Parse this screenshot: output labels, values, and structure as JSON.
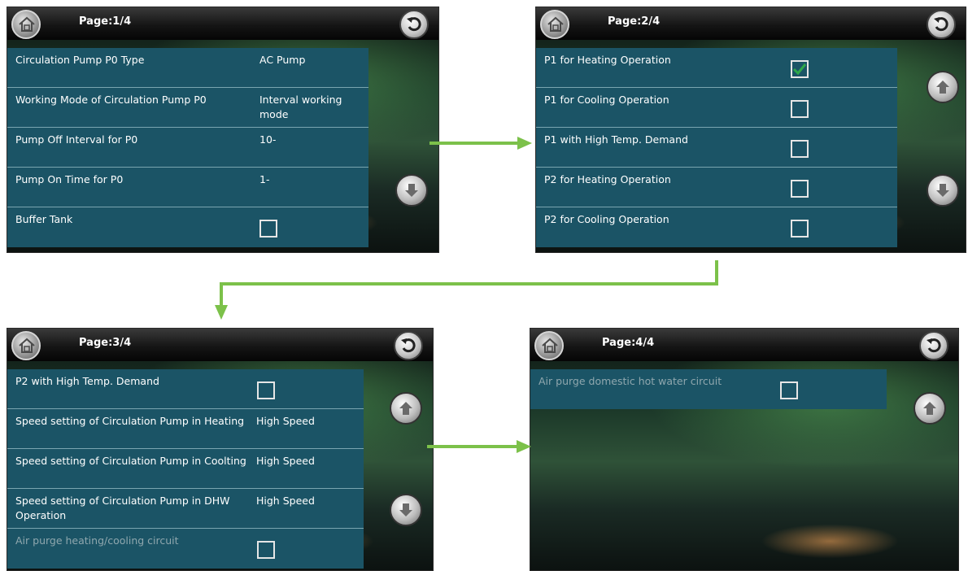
{
  "screens": {
    "s1": {
      "page": "Page:1/4",
      "rows": [
        {
          "label": "Circulation Pump P0 Type",
          "value": "AC Pump"
        },
        {
          "label": "Working Mode of Circulation Pump P0",
          "value": "Interval working mode"
        },
        {
          "label": "Pump Off Interval for P0",
          "value": "10-"
        },
        {
          "label": "Pump On Time for P0",
          "value": "1-"
        },
        {
          "label": "Buffer Tank",
          "value": ""
        }
      ]
    },
    "s2": {
      "page": "Page:2/4",
      "rows": [
        {
          "label": "P1 for Heating Operation",
          "checked": true
        },
        {
          "label": "P1 for Cooling Operation",
          "checked": false
        },
        {
          "label": "P1 with High Temp. Demand",
          "checked": false
        },
        {
          "label": "P2 for Heating Operation",
          "checked": false
        },
        {
          "label": "P2 for Cooling Operation",
          "checked": false
        }
      ]
    },
    "s3": {
      "page": "Page:3/4",
      "rows": [
        {
          "label": "P2 with High Temp. Demand",
          "value": ""
        },
        {
          "label": "Speed setting of Circulation Pump in Heating",
          "value": "High Speed"
        },
        {
          "label": "Speed setting of Circulation Pump in Coolting",
          "value": "High Speed"
        },
        {
          "label": "Speed setting of Circulation Pump in DHW Operation",
          "value": "High Speed"
        },
        {
          "label": "Air purge heating/cooling circuit",
          "value": ""
        }
      ]
    },
    "s4": {
      "page": "Page:4/4",
      "rows": [
        {
          "label": "Air purge domestic hot water circuit",
          "value": ""
        }
      ]
    }
  },
  "colors": {
    "row_bg": "#1b5466",
    "arrow": "#7cc14a",
    "check": "#2fa84a"
  }
}
